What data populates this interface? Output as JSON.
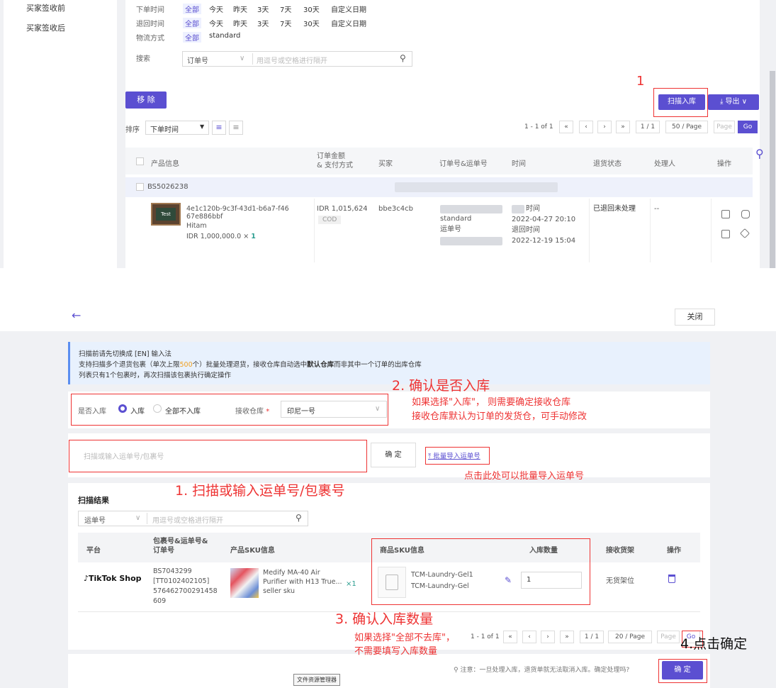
{
  "top": {
    "sidebar": [
      "买家签收前",
      "买家签收后"
    ],
    "filters": [
      {
        "label": "下单时间",
        "options": [
          "全部",
          "今天",
          "昨天",
          "3天",
          "7天",
          "30天",
          "自定义日期"
        ]
      },
      {
        "label": "退回时间",
        "options": [
          "全部",
          "今天",
          "昨天",
          "3天",
          "7天",
          "30天",
          "自定义日期"
        ]
      },
      {
        "label": "物流方式",
        "options": [
          "全部",
          "standard"
        ]
      }
    ],
    "search": {
      "label": "搜索",
      "type": "订单号",
      "placeholder": "用逗号或空格进行隔开"
    },
    "remove_btn": "移 除",
    "scan_btn": "扫描入库",
    "export_btn": "⤓ 导出 ∨",
    "red_num_1": "1",
    "sort_label": "排序",
    "sort_value": "下单时间",
    "pager": {
      "info": "1 - 1 of 1",
      "first": "«",
      "prev": "‹",
      "next": "›",
      "last": "»",
      "pages": "1 / 1",
      "size": "50 / Page",
      "page_ph": "Page",
      "go": "Go"
    },
    "columns": [
      "产品信息",
      "订单金额\n& 支付方式",
      "买家",
      "订单号&运单号",
      "时间",
      "退货状态",
      "处理人",
      "操作"
    ],
    "order_id": "BS5026238",
    "product": {
      "sku": "4e1c120b-9c3f-43d1-b6a7-f4667e886bbf",
      "variant": "Hitam",
      "price": "IDR 1,000,000.0",
      "qty_x": "×",
      "qty": "1"
    },
    "amount": "IDR 1,015,624",
    "payment": "COD",
    "buyer": "bbe3c4cb",
    "shipping": "standard",
    "tracking_label": "运单号",
    "time_label": "时间",
    "order_time": "2022-04-27 20:10",
    "return_label": "退回时间",
    "return_time": "2022-12-19 15:04",
    "status": "已退回未处理",
    "handler": "--"
  },
  "bottom": {
    "back": "←",
    "close": "关闭",
    "notice": [
      "扫描前请先切换成 [EN] 输入法",
      "支持扫描多个退货包裹（单次上限",
      "500",
      "个）批量处理退货，接收仓库自动选中",
      "默认仓库",
      "而非其中一个订单的出库仓库",
      "列表只有1个包裹时，再次扫描该包裹执行确定操作"
    ],
    "step2": "2. 确认是否入库",
    "step2_note1": "如果选择\"入库\"，  则需要确定接收仓库",
    "step2_note2": "接收仓库默认为订单的发货仓，可手动修改",
    "inbound_label": "是否入库",
    "opt_in": "入库",
    "opt_none": "全部不入库",
    "wh_label": "接收仓库",
    "wh_req": "*",
    "wh_value": "印尼一号",
    "scan_placeholder": "扫描或输入运单号/包裹号",
    "confirm": "确 定",
    "batch_import": "⤒ 批量导入运单号",
    "batch_note": "点击此处可以批量导入运单号",
    "step1": "1. 扫描或输入运单号/包裹号",
    "results_title": "扫描结果",
    "rs_type": "运单号",
    "rs_placeholder": "用逗号或空格进行隔开",
    "cols": [
      "平台",
      "包裹号&运单号&\n订单号",
      "产品SKU信息",
      "商品SKU信息",
      "入库数量",
      "接收货架",
      "操作"
    ],
    "platform": "TikTok Shop",
    "pkg": "BS7043299\n[TT0102402105]\n576462700291458\n609",
    "prod_name": "Medify MA-40 Air\nPurifier with H13 True...\nseller sku",
    "prod_qty": "×1",
    "sku1": "TCM-Laundry-Gel1",
    "sku2": "TCM-Laundry-Gel",
    "in_qty": "1",
    "shelf": "无货架位",
    "step3": "3. 确认入库数量",
    "step3_note1": "如果选择\"全部不去库\"，",
    "step3_note2": "不需要填写入库数量",
    "pager": {
      "info": "1 - 1 of 1",
      "pages": "1 / 1",
      "size": "20 / Page",
      "page_ph": "Page",
      "go": "Go"
    },
    "step4": "4.点击确定",
    "warn": "⚲ 注意：一旦处理入库，退货单就无法取消入库。确定处理吗?",
    "ok": "确 定",
    "tooltip": "文件资源管理器"
  }
}
